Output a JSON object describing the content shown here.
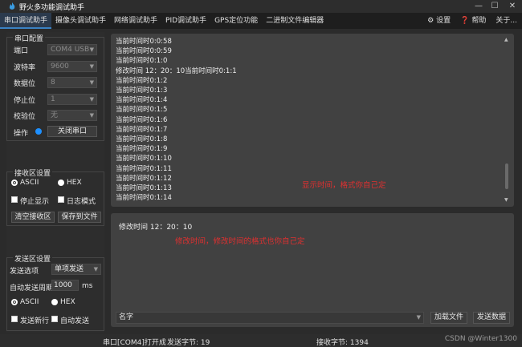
{
  "window": {
    "title": "野火多功能调试助手",
    "min": "—",
    "max": "☐",
    "close": "✕"
  },
  "tabs": [
    "串口调试助手",
    "摄像头调试助手",
    "网络调试助手",
    "PID调试助手",
    "GPS定位功能",
    "二进制文件编辑器"
  ],
  "toolbar": {
    "settings": "设置",
    "help": "帮助",
    "about": "关于..."
  },
  "serial_config": {
    "title": "串口配置",
    "port_label": "端口",
    "port_value": "COM4 USB",
    "baud_label": "波特率",
    "baud_value": "9600",
    "data_label": "数据位",
    "data_value": "8",
    "stop_label": "停止位",
    "stop_value": "1",
    "parity_label": "校验位",
    "parity_value": "无",
    "op_label": "操作",
    "close_button": "关闭串口"
  },
  "recv_config": {
    "title": "接收区设置",
    "ascii": "ASCII",
    "hex": "HEX",
    "stop_display": "停止显示",
    "log_mode": "日志模式",
    "clear_button": "清空接收区",
    "save_button": "保存到文件"
  },
  "send_config": {
    "title": "发送区设置",
    "option_label": "发送选项",
    "option_value": "单项发送",
    "period_label": "自动发送周期",
    "period_value": "1000",
    "period_unit": "ms",
    "ascii": "ASCII",
    "hex": "HEX",
    "newline": "发送新行",
    "auto_send": "自动发送"
  },
  "recv_lines": [
    "当前时间时0:0:58",
    "当前时间时0:0:59",
    "当前时间时0:1:0",
    "修改时间 12：20：10当前时间时0:1:1",
    "当前时间时0:1:2",
    "当前时间时0:1:3",
    "当前时间时0:1:4",
    "当前时间时0:1:5",
    "当前时间时0:1:6",
    "当前时间时0:1:7",
    "当前时间时0:1:8",
    "当前时间时0:1:9",
    "当前时间时0:1:10",
    "当前时间时0:1:11",
    "当前时间时0:1:12",
    "当前时间时0:1:13",
    "当前时间时0:1:14"
  ],
  "recv_note": "显示时间，格式你自己定",
  "send_text": "修改时间 12：20：10",
  "send_note": "修改时间，修改时间的格式也你自己定",
  "send_bar": {
    "name_value": "名字",
    "load_button": "加载文件",
    "send_button": "发送数据"
  },
  "status": {
    "port_open": "串口[COM4]打开成",
    "sent": "发送字节: 19",
    "received": "接收字节: 1394",
    "watermark": "CSDN @Winter1300"
  },
  "colors": {
    "accent": "#1e90ff",
    "note": "#e03030"
  }
}
